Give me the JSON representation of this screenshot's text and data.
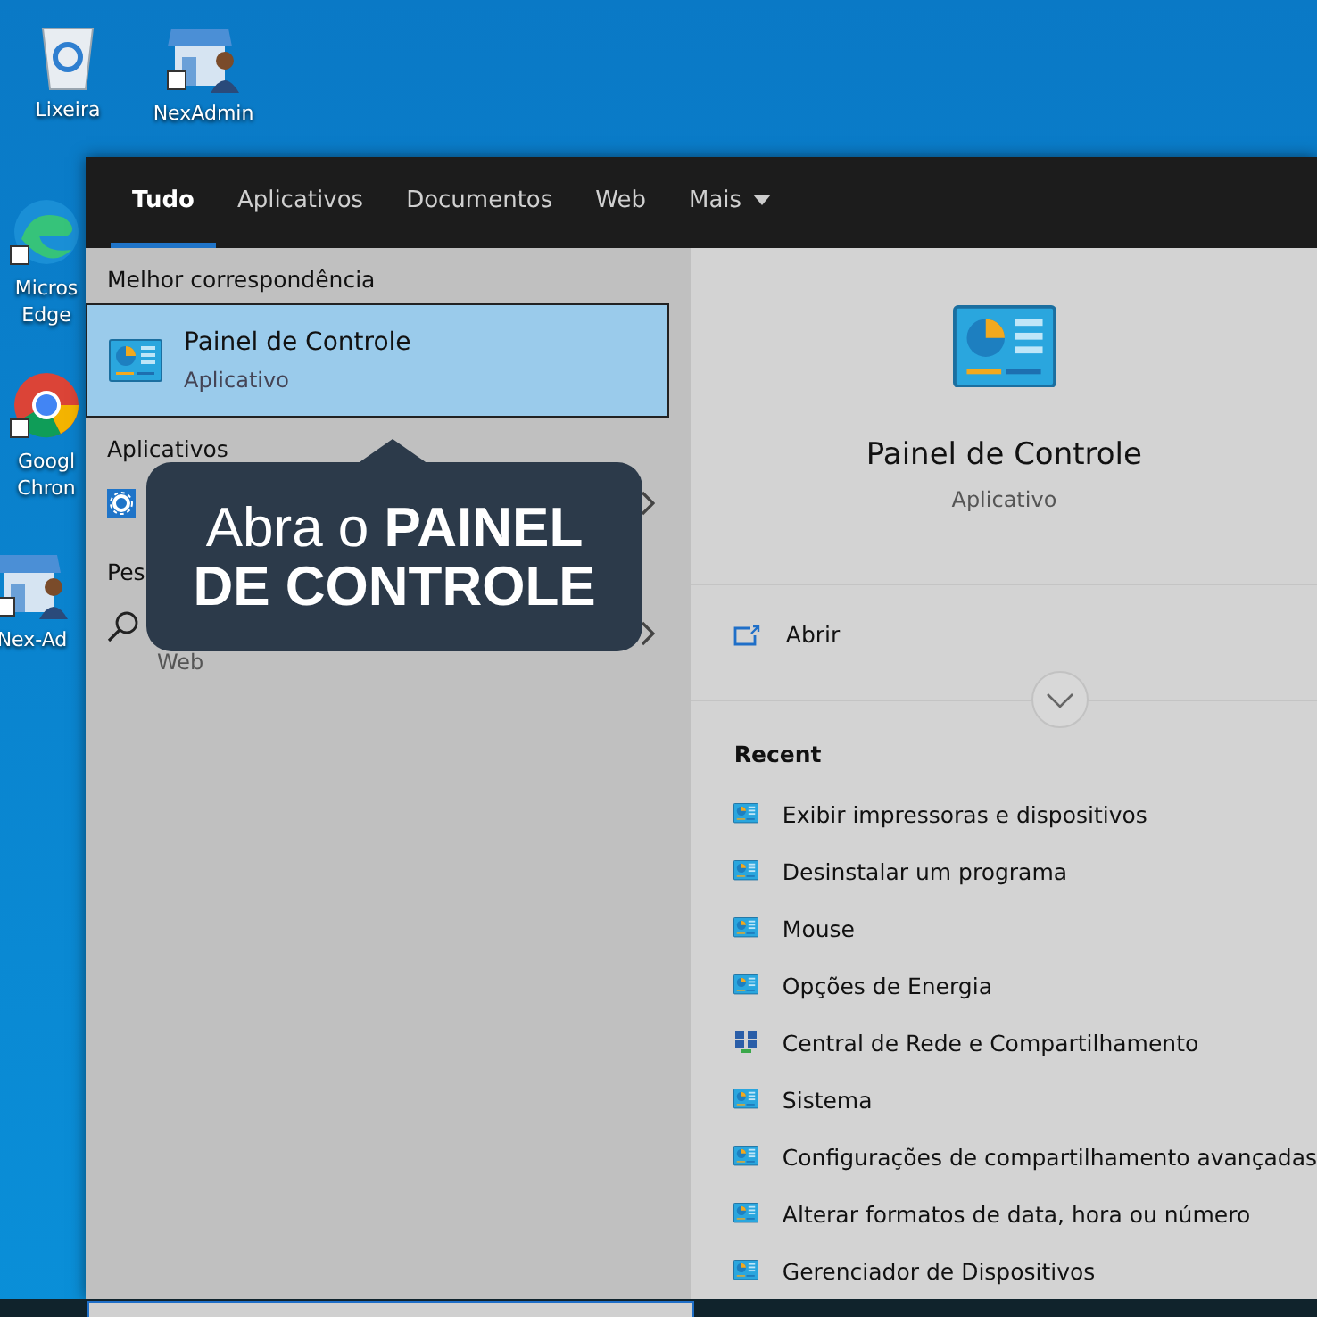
{
  "desktop_icons": [
    {
      "label": "Lixeira",
      "kind": "recycle"
    },
    {
      "label": "NexAdmin",
      "kind": "store"
    },
    {
      "label": "Micros Edge",
      "kind": "edge"
    },
    {
      "label": "Googl Chron",
      "kind": "chrome"
    },
    {
      "label": "Nex-Ad",
      "kind": "store"
    }
  ],
  "tabs": [
    {
      "label": "Tudo",
      "selected": true
    },
    {
      "label": "Aplicativos",
      "selected": false
    },
    {
      "label": "Documentos",
      "selected": false
    },
    {
      "label": "Web",
      "selected": false
    },
    {
      "label": "Mais",
      "selected": false,
      "dropdown": true
    }
  ],
  "left_pane": {
    "best_match_heading": "Melhor correspondência",
    "best_match": {
      "title": "Painel de Controle",
      "subtitle": "Aplicativo",
      "selected": true
    },
    "apps_heading": "Aplicativos",
    "search_heading": "Pes",
    "web_result": {
      "subtitle": "Web"
    }
  },
  "right_pane": {
    "title": "Painel de Controle",
    "subtitle": "Aplicativo",
    "actions": [
      {
        "label": "Abrir"
      }
    ],
    "recent_heading": "Recent",
    "recent": [
      {
        "label": "Exibir impressoras e dispositivos",
        "kind": "panel"
      },
      {
        "label": "Desinstalar um programa",
        "kind": "panel"
      },
      {
        "label": "Mouse",
        "kind": "panel"
      },
      {
        "label": "Opções de Energia",
        "kind": "panel"
      },
      {
        "label": "Central de Rede e Compartilhamento",
        "kind": "network"
      },
      {
        "label": "Sistema",
        "kind": "panel"
      },
      {
        "label": "Configurações de compartilhamento avançadas",
        "kind": "panel"
      },
      {
        "label": "Alterar formatos de data, hora ou número",
        "kind": "panel"
      },
      {
        "label": "Gerenciador de Dispositivos",
        "kind": "panel"
      }
    ]
  },
  "callout": {
    "text": "Abra o **PAINEL DE CONTROLE**"
  }
}
